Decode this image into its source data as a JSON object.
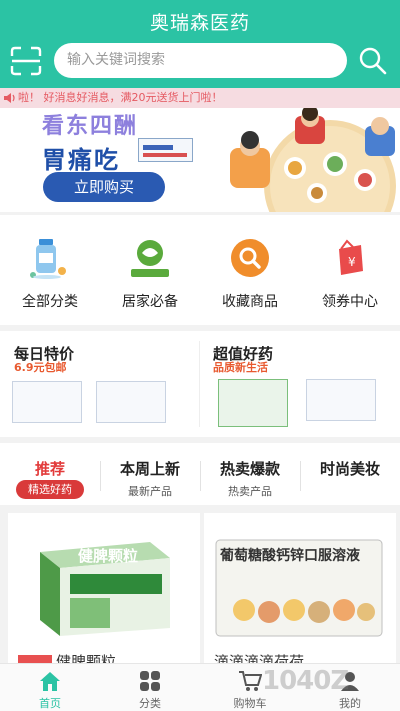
{
  "header": {
    "title": "奥瑞森医药",
    "search_placeholder": "输入关键词搜索",
    "scan_icon": "scan-icon",
    "search_icon": "search-icon",
    "bg_color": "#2bc3a4"
  },
  "notice": {
    "text": "啦！ 好消息好消息，满20元送货上门啦！",
    "icon": "speaker-icon"
  },
  "banner": {
    "slogan": "看东四酬",
    "product": "胃痛吃",
    "button": "立即购买"
  },
  "categories": [
    {
      "label": "全部分类",
      "icon": "medicine-bottle-icon"
    },
    {
      "label": "居家必备",
      "icon": "health-logo-icon"
    },
    {
      "label": "收藏商品",
      "icon": "search-circle-icon"
    },
    {
      "label": "领券中心",
      "icon": "coupon-bag-icon"
    }
  ],
  "promos": [
    {
      "title": "每日特价",
      "subtitle": "6.9元包邮"
    },
    {
      "title": "超值好药",
      "subtitle": "品质新生活"
    }
  ],
  "tabs": [
    {
      "title": "推荐",
      "subtitle": "精选好药",
      "active": true
    },
    {
      "title": "本周上新",
      "subtitle": "最新产品",
      "active": false
    },
    {
      "title": "热卖爆款",
      "subtitle": "热卖产品",
      "active": false
    },
    {
      "title": "时尚美妆",
      "subtitle": "",
      "active": false
    }
  ],
  "products": [
    {
      "name": "健脾颗粒",
      "box_text": "健脾颗粒"
    },
    {
      "name": "滴滴滴滴荷荷",
      "box_text": "葡萄糖酸钙锌口服溶液"
    }
  ],
  "bottom_nav": [
    {
      "label": "首页",
      "icon": "home-icon",
      "active": true
    },
    {
      "label": "分类",
      "icon": "grid-icon",
      "active": false
    },
    {
      "label": "购物车",
      "icon": "cart-icon",
      "active": false
    },
    {
      "label": "我的",
      "icon": "user-icon",
      "active": false
    }
  ],
  "watermark": "1040Z"
}
